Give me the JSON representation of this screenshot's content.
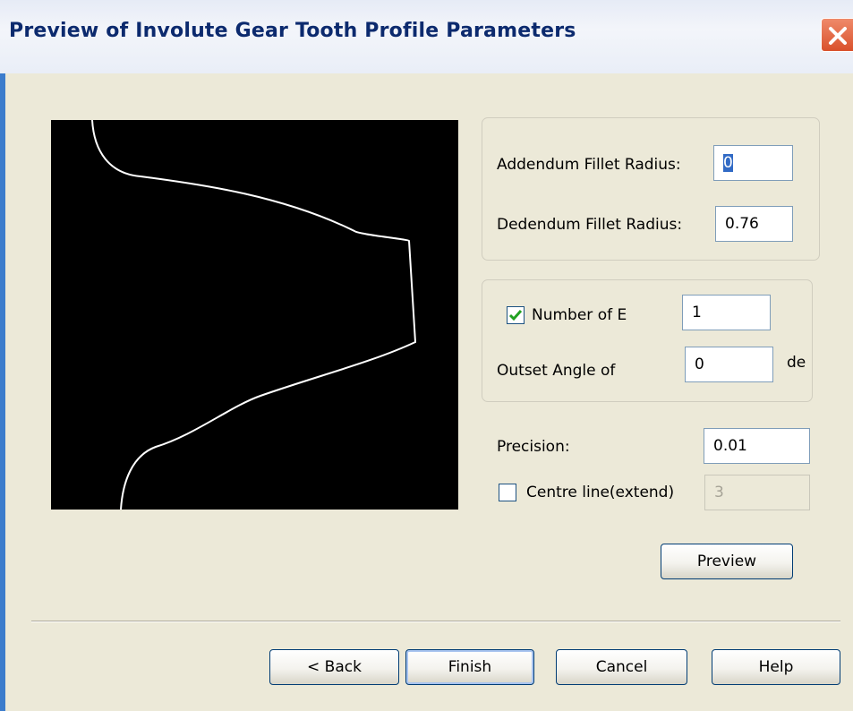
{
  "window": {
    "title": "Preview of Involute Gear Tooth  Profile Parameters",
    "close_icon": "close-icon",
    "accent_color": "#0c2a6e",
    "close_color": "#d9512c"
  },
  "fillets": {
    "addendum_label": "Addendum Fillet Radius:",
    "addendum_value": "0",
    "dedendum_label": "Dedendum Fillet Radius:",
    "dedendum_value": "0.76"
  },
  "elements": {
    "number_checked": true,
    "number_label": "Number of E",
    "number_value": "1",
    "outset_label": "Outset Angle of",
    "outset_value": "0",
    "outset_unit": "de"
  },
  "precision": {
    "label": "Precision:",
    "value": "0.01"
  },
  "centre_line": {
    "checked": false,
    "label": "Centre line(extend)",
    "value": "3"
  },
  "buttons": {
    "preview": "Preview",
    "back": "< Back",
    "finish": "Finish",
    "cancel": "Cancel",
    "help": "Help"
  }
}
